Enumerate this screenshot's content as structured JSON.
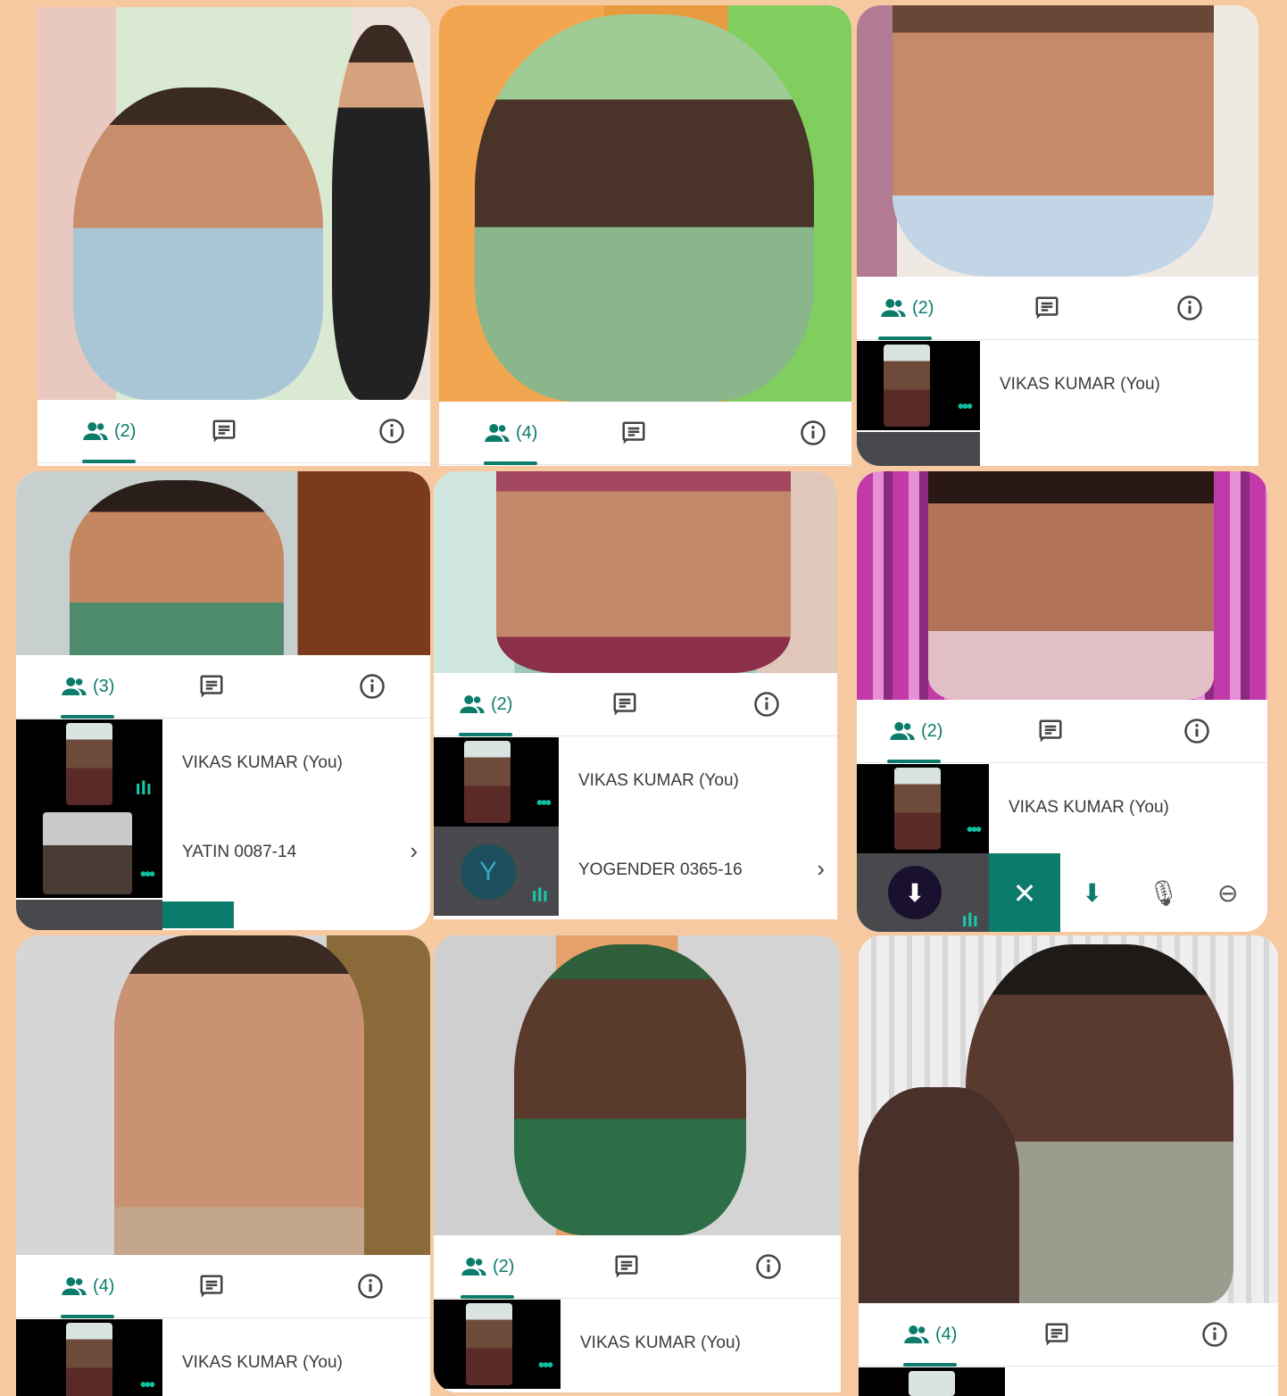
{
  "accent_color": "#0b7c6b",
  "panels": [
    {
      "people_count": "(2)"
    },
    {
      "people_count": "(4)"
    },
    {
      "people_count": "(2)",
      "participants": [
        "VIKAS KUMAR (You)"
      ]
    },
    {
      "people_count": "(3)",
      "participants": [
        "VIKAS KUMAR (You)",
        "YATIN 0087-14"
      ]
    },
    {
      "people_count": "(2)",
      "participants": [
        "VIKAS KUMAR (You)",
        "YOGENDER 0365-16"
      ],
      "avatar_letter": "Y"
    },
    {
      "people_count": "(2)",
      "participants": [
        "VIKAS KUMAR (You)"
      ]
    },
    {
      "people_count": "(4)",
      "participants": [
        "VIKAS KUMAR (You)"
      ]
    },
    {
      "people_count": "(2)",
      "participants": [
        "VIKAS KUMAR (You)"
      ]
    },
    {
      "people_count": "(4)"
    }
  ],
  "icons": {
    "people": "people-icon",
    "chat": "chat-icon",
    "info": "info-icon"
  }
}
